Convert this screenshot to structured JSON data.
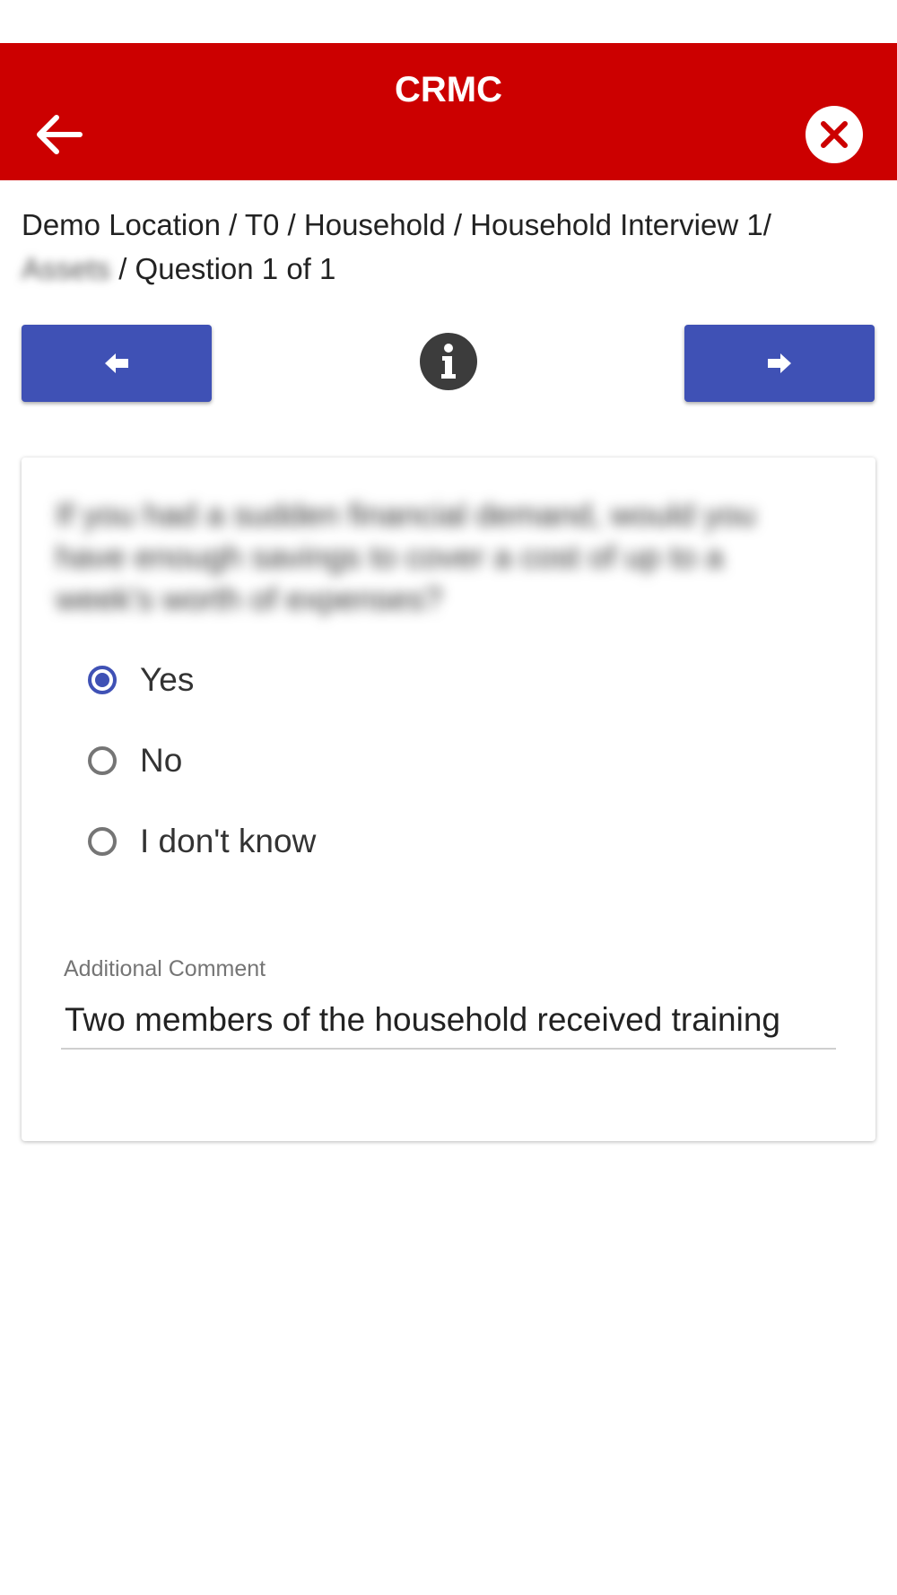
{
  "header": {
    "title": "CRMC",
    "back_icon": "arrow-left-icon",
    "close_icon": "close-icon",
    "accent_color": "#cc0000"
  },
  "breadcrumb": {
    "line1": "Demo Location / T0 / Household / Household Interview 1/",
    "section": "Assets",
    "line2_rest": " / Question 1 of 1"
  },
  "navigation": {
    "prev_icon": "arrow-left-icon",
    "next_icon": "arrow-right-icon",
    "info_icon": "info-icon",
    "button_color": "#3f51b5"
  },
  "question": {
    "text": "If you had a sudden financial demand, would you have enough savings to cover a cost of up to a week's worth of expenses?",
    "options": [
      "Yes",
      "No",
      "I don't know"
    ],
    "selected": "Yes"
  },
  "comment": {
    "label": "Additional Comment",
    "value": "Two members of the household received training"
  }
}
